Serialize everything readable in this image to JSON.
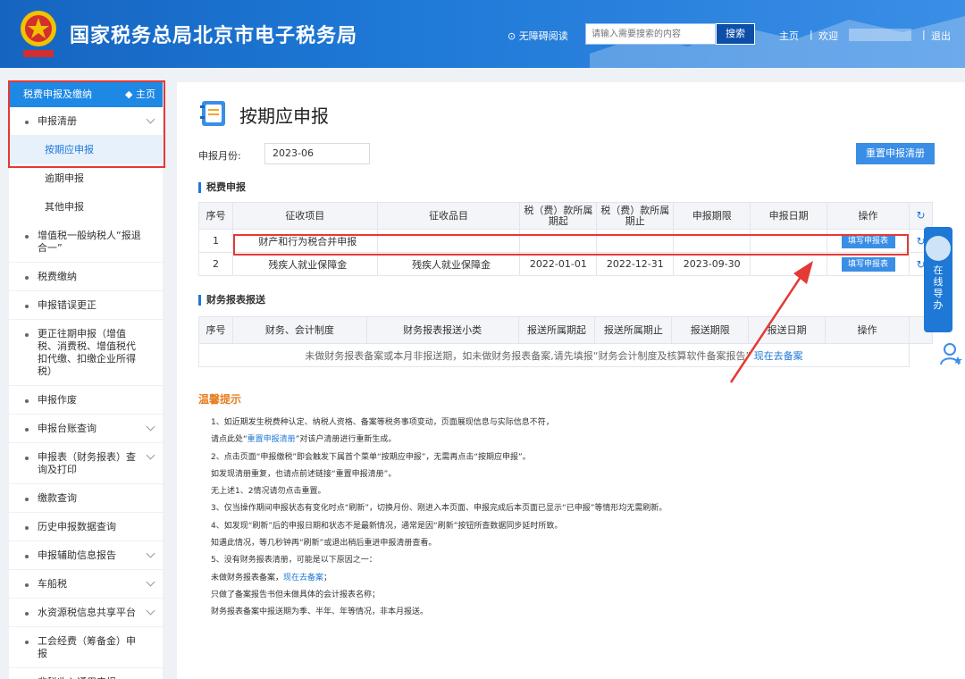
{
  "header": {
    "site_title": "国家税务总局北京市电子税务局",
    "accessibility": "⊙ 无障碍阅读",
    "search_placeholder": "请输入需要搜索的内容",
    "search_button": "搜索",
    "home": "主页",
    "welcome": "欢迎",
    "logout": "退出",
    "separator": "|"
  },
  "sidebar": {
    "head_title": "税费申报及缴纳",
    "home_link": "◆ 主页",
    "items": [
      {
        "label": "申报清册",
        "chevron": true
      },
      {
        "label": "按期应申报",
        "sub": true,
        "active": true
      },
      {
        "label": "逾期申报",
        "sub": true
      },
      {
        "label": "其他申报",
        "sub": true
      },
      {
        "label": "增值税一般纳税人“报退合一”"
      },
      {
        "label": "税费缴纳"
      },
      {
        "label": "申报错误更正"
      },
      {
        "label": "更正往期申报（增值税、消费税、增值税代扣代缴、扣缴企业所得税）"
      },
      {
        "label": "申报作废"
      },
      {
        "label": "申报台账查询",
        "chevron": true
      },
      {
        "label": "申报表（财务报表）查询及打印",
        "chevron": true
      },
      {
        "label": "缴款查询"
      },
      {
        "label": "历史申报数据查询"
      },
      {
        "label": "申报辅助信息报告",
        "chevron": true
      },
      {
        "label": "车船税",
        "chevron": true
      },
      {
        "label": "水资源税信息共享平台",
        "chevron": true
      },
      {
        "label": "工会经费（筹备金）申报"
      },
      {
        "label": "非税收入通用申报",
        "chevron": true
      }
    ]
  },
  "main": {
    "page_title": "按期应申报",
    "month_label": "申报月份:",
    "month_value": "2023-06",
    "reset_button": "重置申报清册",
    "tax_section": "税费申报",
    "tax_table": {
      "headers": [
        "序号",
        "征收项目",
        "征收品目",
        "税（费）款所属期起",
        "税（费）款所属期止",
        "申报期限",
        "申报日期",
        "操作"
      ],
      "rows": [
        {
          "no": "1",
          "item": "财产和行为税合并申报",
          "category": "",
          "start": "",
          "end": "",
          "deadline": "",
          "date": "",
          "action": "填写申报表"
        },
        {
          "no": "2",
          "item": "残疾人就业保障金",
          "category": "残疾人就业保障金",
          "start": "2022-01-01",
          "end": "2022-12-31",
          "deadline": "2023-09-30",
          "date": "",
          "action": "填写申报表"
        }
      ]
    },
    "finance_section": "财务报表报送",
    "finance_table": {
      "headers": [
        "序号",
        "财务、会计制度",
        "财务报表报送小类",
        "报送所属期起",
        "报送所属期止",
        "报送期限",
        "报送日期",
        "操作"
      ],
      "empty_text": "未做财务报表备案或本月非报送期，如未做财务报表备案,请先填报“财务会计制度及核算软件备案报告”",
      "empty_link": "现在去备案"
    },
    "tips_title": "温馨提示",
    "tips": [
      {
        "text": "1、如近期发生税费种认定、纳税人资格、备案等税务事项变动，页面展现信息与实际信息不符，"
      },
      {
        "pre": "请点此处“",
        "link": "重置申报清册",
        "post": "”对该户清册进行重新生成。"
      },
      {
        "text": "2、点击页面“申报缴税”即会触发下属首个菜单“按期应申报”，无需再点击“按期应申报”。"
      },
      {
        "text": "如发现清册重复，也请点前述链接“重置申报清册”。"
      },
      {
        "text": "无上述1、2情况请勿点击重置。"
      },
      {
        "text": "3、仅当操作期间申报状态有变化时点“刷新”，切换月份、刚进入本页面、申报完成后本页面已显示“已申报”等情形均无需刷新。"
      },
      {
        "text": "4、如发现“刷新”后的申报日期和状态不是最新情况，通常是因“刷新”按钮所查数据同步延时所致。"
      },
      {
        "text": "知遇此情况，等几秒钟再“刷新”或退出稍后重进申报清册查看。"
      },
      {
        "text": "5、没有财务报表清册，可能是以下原因之一："
      },
      {
        "pre": "未做财务报表备案，",
        "link": "现在去备案",
        "post": "；"
      },
      {
        "text": "只做了备案报告书但未做具体的会计报表名称；"
      },
      {
        "text": "财务报表备案中报送期为季、半年、年等情况，非本月报送。"
      }
    ]
  },
  "float_guide": {
    "label": "在线导办"
  },
  "colors": {
    "brand": "#1e78d6",
    "highlight": "#e53935",
    "tips_title": "#e67e22"
  }
}
